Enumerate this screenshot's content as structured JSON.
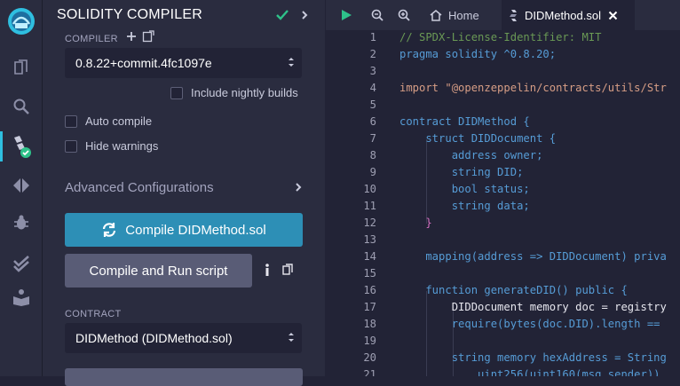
{
  "panel": {
    "title": "SOLIDITY COMPILER",
    "compiler_label": "COMPILER",
    "compiler_version": "0.8.22+commit.4fc1097e",
    "nightly_label": "Include nightly builds",
    "auto_compile_label": "Auto compile",
    "hide_warnings_label": "Hide warnings",
    "advanced_label": "Advanced Configurations",
    "compile_button": "Compile DIDMethod.sol",
    "run_button": "Compile and Run script",
    "contract_label": "CONTRACT",
    "contract_value": "DIDMethod (DIDMethod.sol)"
  },
  "tabs": {
    "home": "Home",
    "file": "DIDMethod.sol"
  },
  "colors": {
    "accent": "#2fbfe0",
    "compile_button": "#2d8fb6",
    "run_button": "#595c76",
    "success": "#2ec28a"
  },
  "editor": {
    "line_numbers": [
      "1",
      "2",
      "3",
      "4",
      "5",
      "6",
      "7",
      "8",
      "9",
      "10",
      "11",
      "12",
      "13",
      "14",
      "15",
      "16",
      "17",
      "18",
      "19",
      "20",
      "21"
    ],
    "lines": [
      "// SPDX-License-Identifier: MIT",
      "pragma solidity ^0.8.20;",
      "",
      "import \"@openzeppelin/contracts/utils/Str",
      "",
      "contract DIDMethod {",
      "    struct DIDDocument {",
      "        address owner;",
      "        string DID;",
      "        bool status;",
      "        string data;",
      "    }",
      "",
      "    mapping(address => DIDDocument) priva",
      "",
      "    function generateDID() public {",
      "        DIDDocument memory doc = registry",
      "        require(bytes(doc.DID).length ==",
      "",
      "        string memory hexAddress = String",
      "            uint256(uint160(msg.sender))"
    ]
  }
}
